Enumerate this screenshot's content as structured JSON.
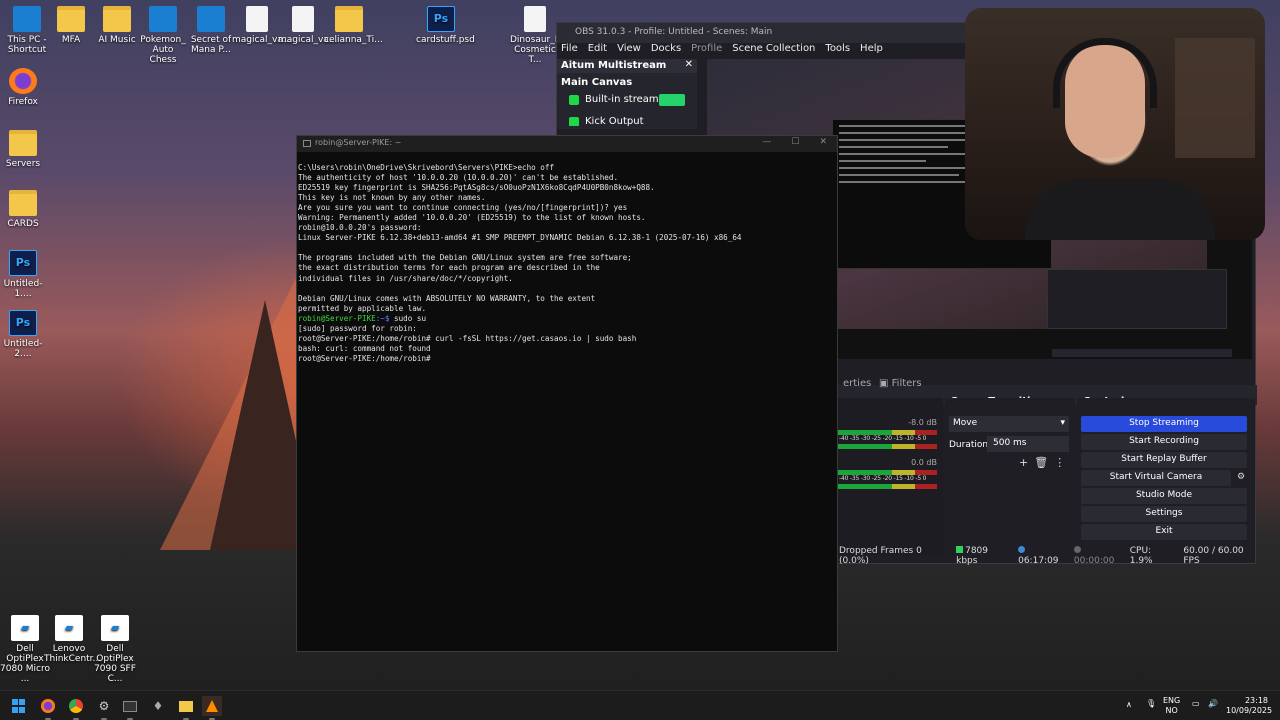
{
  "desktop": {
    "icons_top": [
      {
        "label": "This PC - Shortcut",
        "type": "pc"
      },
      {
        "label": "MFA",
        "type": "folder"
      },
      {
        "label": "AI Music",
        "type": "folder"
      },
      {
        "label": "Pokemon_ Auto Chess",
        "type": "app"
      },
      {
        "label": "Secret of Mana P...",
        "type": "app"
      },
      {
        "label": "magical_va...",
        "type": "doc"
      },
      {
        "label": "magical_va...",
        "type": "doc"
      },
      {
        "label": "celianna_Ti...",
        "type": "folder"
      },
      {
        "label": "cardstuff.psd",
        "type": "psd"
      },
      {
        "label": "Dinosaur_Pl... Cosmetic T...",
        "type": "doc"
      }
    ],
    "icons_left": [
      {
        "label": "Firefox"
      },
      {
        "label": "Servers"
      },
      {
        "label": "CARDS"
      },
      {
        "label": "Untitled-1...."
      },
      {
        "label": "Untitled-2...."
      }
    ],
    "icons_bottom": [
      {
        "label": "Dell OptiPlex 7080 Micro ..."
      },
      {
        "label": "Lenovo ThinkCentr..."
      },
      {
        "label": "Dell OptiPlex 7090 SFF C..."
      }
    ]
  },
  "obs": {
    "title": "OBS 31.0.3 - Profile: Untitled - Scenes: Main",
    "menu": [
      "File",
      "Edit",
      "View",
      "Docks",
      "Profile",
      "Scene Collection",
      "Tools",
      "Help"
    ],
    "multistream": {
      "title": "Aitum Multistream",
      "canvas": "Main Canvas",
      "outputs": [
        {
          "label": "Built-in stream"
        },
        {
          "label": "Kick Output"
        }
      ]
    },
    "properties_tab": "erties",
    "filters_tab": "Filters",
    "mixer": {
      "tracks": [
        {
          "db": "-8.0 dB"
        },
        {
          "db": "0.0 dB"
        }
      ],
      "scale": "-40 -35 -30 -25 -20 -15 -10 -5 0"
    },
    "scene_transitions": {
      "title": "Scene Transitions",
      "transition": "Move",
      "duration_label": "Duration",
      "duration_value": "500 ms"
    },
    "controls": {
      "title": "Controls",
      "buttons": [
        "Stop Streaming",
        "Start Recording",
        "Start Replay Buffer",
        "Start Virtual Camera",
        "Studio Mode",
        "Settings",
        "Exit"
      ]
    },
    "status": {
      "dropped": "Dropped Frames 0 (0.0%)",
      "bitrate": "7809 kbps",
      "stream_time": "06:17:09",
      "rec_time": "00:00:00",
      "cpu": "CPU: 1.9%",
      "fps": "60.00 / 60.00 FPS"
    }
  },
  "terminal": {
    "title": "robin@Server-PIKE: ~",
    "lines": [
      {
        "text": "C:\\Users\\robin\\OneDrive\\Skrivebord\\Servers\\PIKE>echo off"
      },
      {
        "text": "The authenticity of host '10.0.0.20 (10.0.0.20)' can't be established."
      },
      {
        "text": "ED25519 key fingerprint is SHA256:PqtASg8cs/sO0uoPzN1X6ko8CqdP4U0PB0n8kow+Q88."
      },
      {
        "text": "This key is not known by any other names."
      },
      {
        "text": "Are you sure you want to continue connecting (yes/no/[fingerprint])? yes"
      },
      {
        "text": "Warning: Permanently added '10.0.0.20' (ED25519) to the list of known hosts."
      },
      {
        "text": "robin@10.0.0.20's password:"
      },
      {
        "text": "Linux Server-PIKE 6.12.38+deb13-amd64 #1 SMP PREEMPT_DYNAMIC Debian 6.12.38-1 (2025-07-16) x86_64"
      },
      {
        "text": ""
      },
      {
        "text": "The programs included with the Debian GNU/Linux system are free software;"
      },
      {
        "text": "the exact distribution terms for each program are described in the"
      },
      {
        "text": "individual files in /usr/share/doc/*/copyright."
      },
      {
        "text": ""
      },
      {
        "text": "Debian GNU/Linux comes with ABSOLUTELY NO WARRANTY, to the extent"
      },
      {
        "text": "permitted by applicable law."
      },
      {
        "prompt_user": "robin@Server-PIKE",
        "prompt_path": ":~$",
        "text": " sudo su"
      },
      {
        "text": "[sudo] password for robin:"
      },
      {
        "text": "root@Server-PIKE:/home/robin# curl -fsSL https://get.casaos.io | sudo bash"
      },
      {
        "text": "bash: curl: command not found"
      },
      {
        "text": "root@Server-PIKE:/home/robin#"
      }
    ]
  },
  "taskbar": {
    "lang": "ENG",
    "region": "NO",
    "time": "23:18",
    "date": "10/09/2025"
  }
}
